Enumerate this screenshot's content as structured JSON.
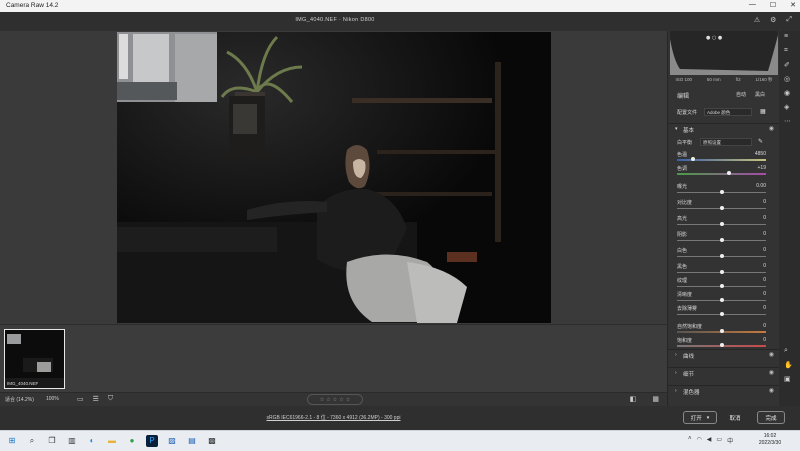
{
  "window": {
    "title": "Camera Raw 14.2",
    "minimize": "—",
    "maximize": "☐",
    "close": "✕"
  },
  "header": {
    "file_title": "IMG_4040.NEF  ·  Nikon D800",
    "icons": [
      "alert-icon",
      "settings-icon",
      "expand-icon"
    ]
  },
  "filmstrip": {
    "thumb_label": "IMG_4040.NEF"
  },
  "bottombar": {
    "zoom_label": "适合 (14.2%)",
    "zoom_value": "100%",
    "stars": [
      "☆",
      "☆",
      "☆",
      "☆",
      "☆"
    ]
  },
  "workflow": {
    "text": "sRGB IEC61966-2.1 - 8 位 - 7360 x 4912 (36.2MP) - 300 ppi"
  },
  "actions": {
    "open_label": "打开",
    "cancel_label": "取消",
    "done_label": "完成"
  },
  "histogram": {
    "info": [
      "ISO 100",
      "50 mm",
      "f/2",
      "1/160 秒"
    ]
  },
  "panel": {
    "edit_label": "编辑",
    "auto_label": "自动",
    "bw_label": "黑白",
    "profile_label": "配置文件",
    "profile_value": "Adobe 颜色",
    "basic_label": "基本",
    "wb_label": "白平衡",
    "wb_value": "原照设置",
    "temp": {
      "label": "色温",
      "value": "4850",
      "pos": 0.18
    },
    "tint": {
      "label": "色调",
      "value": "+19",
      "pos": 0.58
    },
    "sliders": [
      {
        "label": "曝光",
        "value": "0.00",
        "pos": 0.5
      },
      {
        "label": "对比度",
        "value": "0",
        "pos": 0.5
      },
      {
        "label": "高光",
        "value": "0",
        "pos": 0.5
      },
      {
        "label": "阴影",
        "value": "0",
        "pos": 0.5
      },
      {
        "label": "白色",
        "value": "0",
        "pos": 0.5
      },
      {
        "label": "黑色",
        "value": "0",
        "pos": 0.5
      }
    ],
    "sliders2": [
      {
        "label": "纹理",
        "value": "0",
        "pos": 0.5
      },
      {
        "label": "清晰度",
        "value": "0",
        "pos": 0.5
      },
      {
        "label": "去除薄雾",
        "value": "0",
        "pos": 0.5
      }
    ],
    "sliders3": [
      {
        "label": "自然饱和度",
        "value": "0",
        "pos": 0.5
      },
      {
        "label": "饱和度",
        "value": "0",
        "pos": 0.5
      }
    ],
    "sections": [
      "曲线",
      "细节",
      "混色器"
    ]
  },
  "taskbar": {
    "time": "16:02",
    "date": "2022/3/30"
  }
}
